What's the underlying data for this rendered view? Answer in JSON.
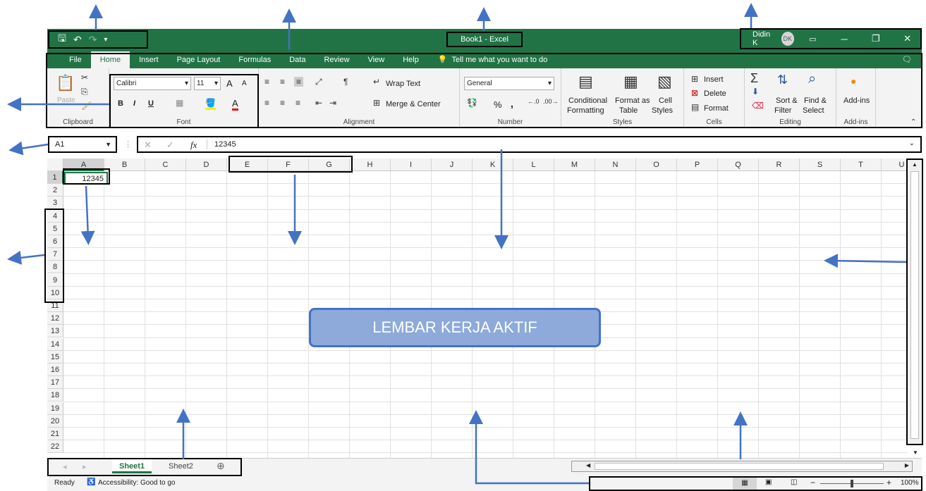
{
  "title_bar": {
    "title": "Book1  -  Excel",
    "user_name": "Didin K",
    "user_initials": "DK",
    "minimize": "─",
    "restore": "❐",
    "close": "✕",
    "qat_save": "🖫",
    "qat_undo": "↶",
    "qat_redo": "↷",
    "qat_customize": "▾"
  },
  "tabs": [
    "File",
    "Home",
    "Insert",
    "Page Layout",
    "Formulas",
    "Data",
    "Review",
    "View",
    "Help"
  ],
  "tell_me": "Tell me what you want to do",
  "ribbon": {
    "clipboard": {
      "label": "Clipboard",
      "paste": "Paste"
    },
    "font": {
      "label": "Font",
      "name": "Calibri",
      "size": "11",
      "bold": "B",
      "italic": "I",
      "underline": "U",
      "grow": "A",
      "shrink": "A",
      "font_color": "A"
    },
    "alignment": {
      "label": "Alignment",
      "wrap": "Wrap Text",
      "merge": "Merge & Center"
    },
    "number": {
      "label": "Number",
      "format": "General",
      "percent": "%",
      "comma": ","
    },
    "styles": {
      "label": "Styles",
      "conditional_1": "Conditional",
      "conditional_2": "Formatting",
      "format_table_1": "Format as",
      "format_table_2": "Table",
      "cell_styles_1": "Cell",
      "cell_styles_2": "Styles"
    },
    "cells": {
      "label": "Cells",
      "insert": "Insert",
      "delete": "Delete",
      "format": "Format"
    },
    "editing": {
      "label": "Editing",
      "sort_1": "Sort &",
      "sort_2": "Filter",
      "find_1": "Find &",
      "find_2": "Select"
    },
    "addins": {
      "label": "Add-ins",
      "addins": "Add-ins"
    }
  },
  "formula_bar": {
    "name_box": "A1",
    "cancel": "✕",
    "enter": "✓",
    "fx": "fx",
    "value": "12345"
  },
  "columns": [
    "A",
    "B",
    "C",
    "D",
    "E",
    "F",
    "G",
    "H",
    "I",
    "J",
    "K",
    "L",
    "M",
    "N",
    "O",
    "P",
    "Q",
    "R",
    "S",
    "T",
    "U"
  ],
  "rows": [
    "1",
    "2",
    "3",
    "4",
    "5",
    "6",
    "7",
    "8",
    "9",
    "10",
    "11",
    "12",
    "13",
    "14",
    "15",
    "16",
    "17",
    "18",
    "19",
    "20",
    "21",
    "22"
  ],
  "cell_a1": "12345",
  "sheets": [
    "Sheet1",
    "Sheet2"
  ],
  "add_sheet": "⊕",
  "status": {
    "ready": "Ready",
    "accessibility": "Accessibility: Good to go",
    "zoom": "100%",
    "zoom_minus": "−",
    "zoom_plus": "+"
  },
  "overlay_label": "LEMBAR KERJA AKTIF",
  "colors": {
    "excel_green": "#217346",
    "arrow_blue": "#4472c4",
    "overlay_fill": "#8eaadb"
  }
}
